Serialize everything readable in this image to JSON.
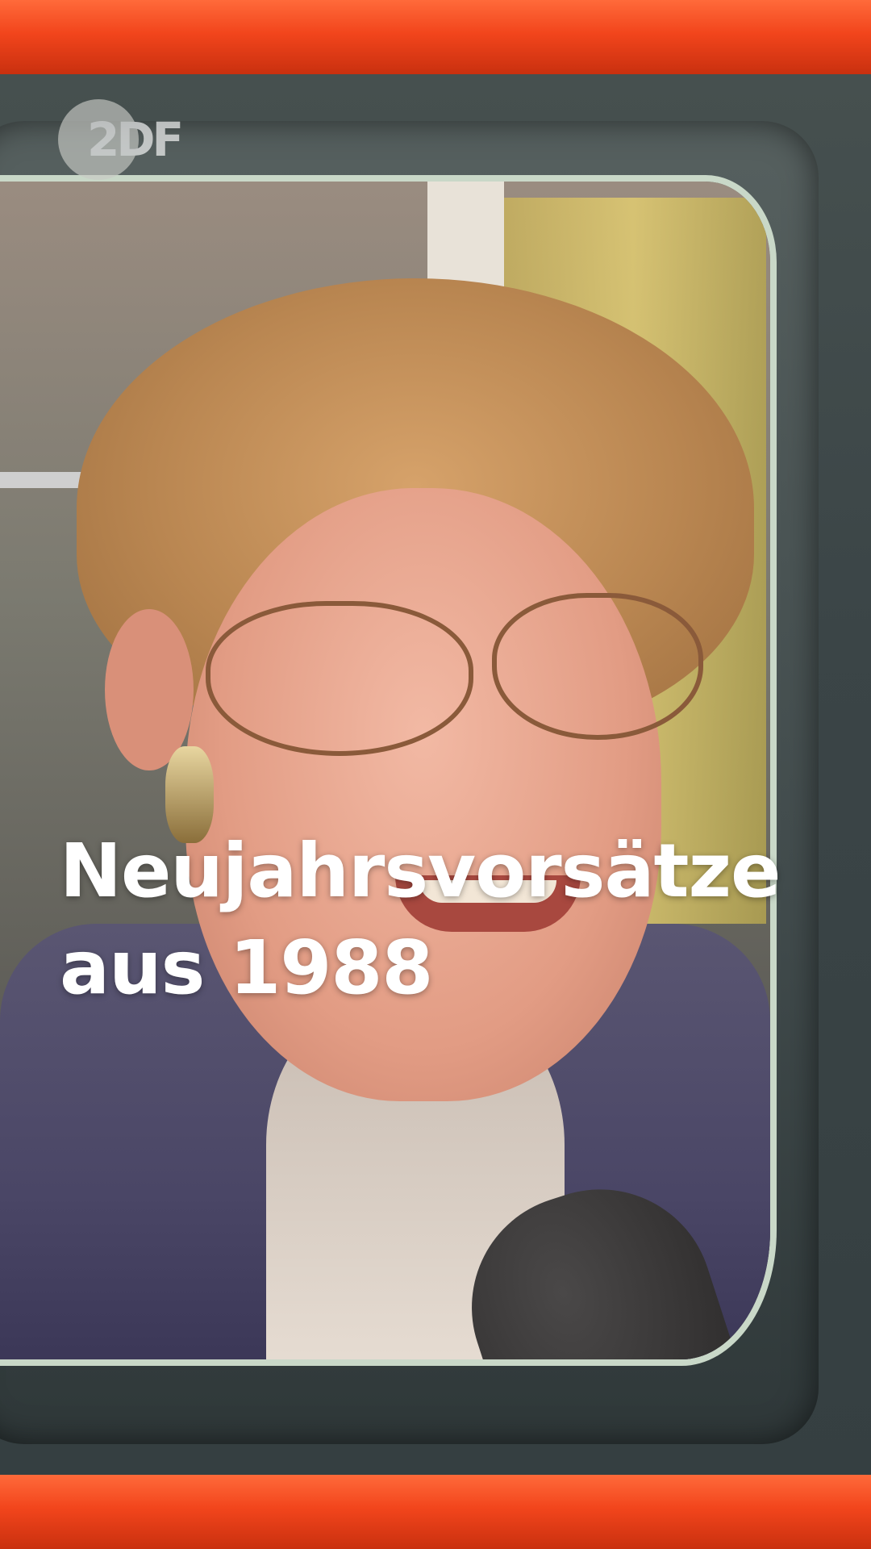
{
  "logo": {
    "text": "2DF"
  },
  "title": {
    "line1": "Neujahrsvorsätze",
    "line2": "aus 1988"
  },
  "colors": {
    "stripe": "#f2451c",
    "tv_frame": "#3b4547",
    "title_text": "#ffffff"
  }
}
